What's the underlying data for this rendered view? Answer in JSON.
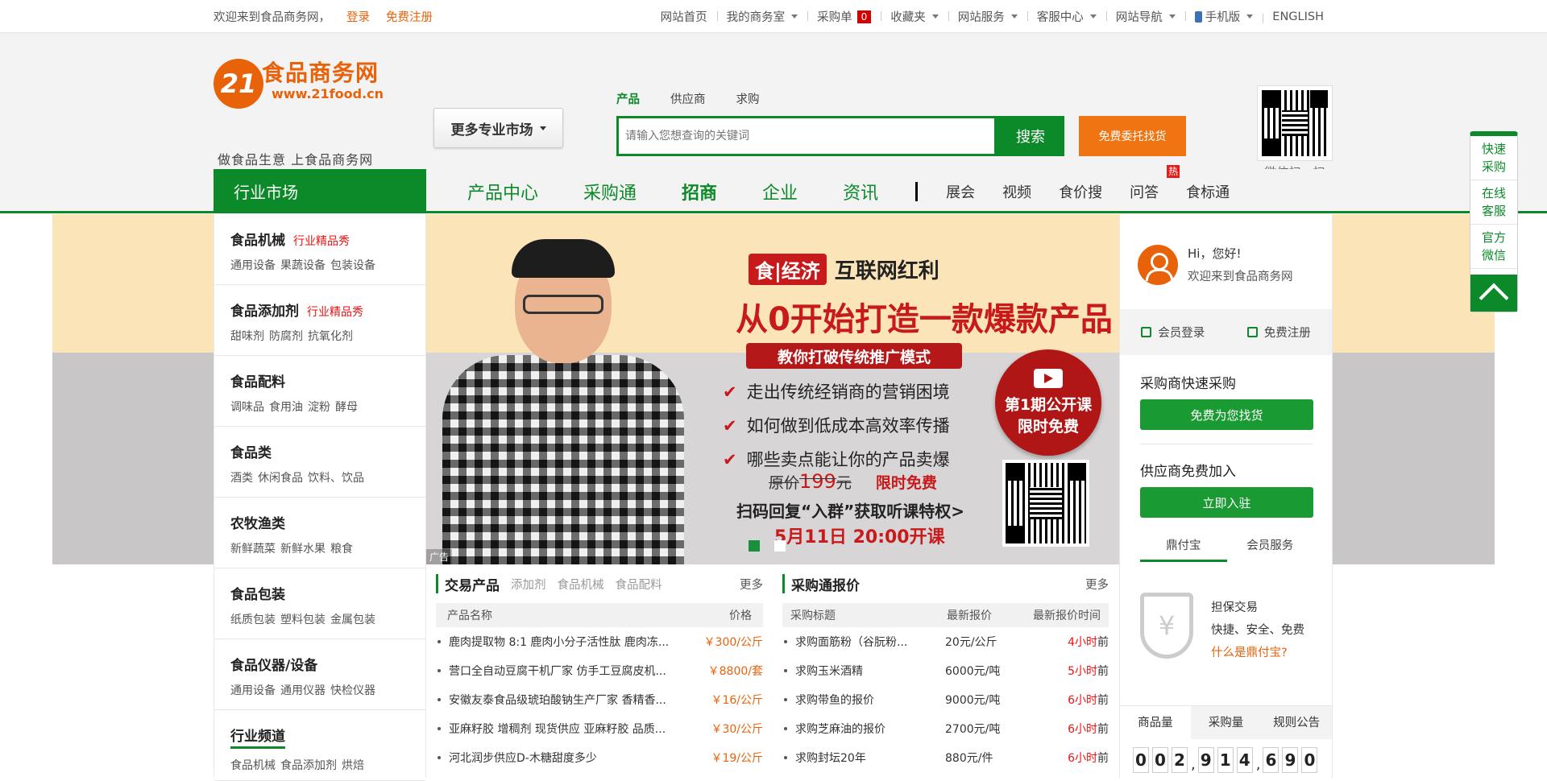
{
  "topbar": {
    "welcome": "欢迎来到食品商务网，",
    "login": "登录",
    "register": "免费注册",
    "links": [
      "网站首页",
      "我的商务室",
      "采购单",
      "收藏夹",
      "网站服务",
      "客服中心",
      "网站导航",
      "手机版",
      "ENGLISH"
    ],
    "cart_count": "0"
  },
  "header": {
    "logo_num": "21",
    "logo_cn": "食品商务网",
    "logo_url": "www.21food.cn",
    "slogan": "做食品生意 上食品商务网",
    "market_btn": "更多专业市场",
    "search_tabs": [
      "产品",
      "供应商",
      "求购"
    ],
    "search_placeholder": "请输入您想查询的关键词",
    "search_btn": "搜索",
    "entrust_btn": "免费委托找货",
    "qr_caption": "微信扫一扫"
  },
  "nav": {
    "category": "行业市场",
    "big_items": [
      "产品中心",
      "采购通",
      "招商",
      "企业",
      "资讯"
    ],
    "small_items": [
      "展会",
      "视频",
      "食价搜",
      "问答",
      "食标通"
    ],
    "hot_badge": "热"
  },
  "sidebar": {
    "groups": [
      {
        "title": "食品机械",
        "tag": "行业精品秀",
        "links": [
          "通用设备",
          "果蔬设备",
          "包装设备"
        ]
      },
      {
        "title": "食品添加剂",
        "tag": "行业精品秀",
        "links": [
          "甜味剂",
          "防腐剂",
          "抗氧化剂"
        ]
      },
      {
        "title": "食品配料",
        "tag": "",
        "links": [
          "调味品",
          "食用油",
          "淀粉",
          "酵母"
        ]
      },
      {
        "title": "食品类",
        "tag": "",
        "links": [
          "酒类",
          "休闲食品",
          "饮料、饮品"
        ]
      },
      {
        "title": "农牧渔类",
        "tag": "",
        "links": [
          "新鲜蔬菜",
          "新鲜水果",
          "粮食"
        ]
      },
      {
        "title": "食品包装",
        "tag": "",
        "links": [
          "纸质包装",
          "塑料包装",
          "金属包装"
        ]
      },
      {
        "title": "食品仪器/设备",
        "tag": "",
        "links": [
          "通用设备",
          "通用仪器",
          "快检仪器"
        ]
      },
      {
        "title": "行业频道",
        "tag": "",
        "links": [
          "食品机械",
          "食品添加剂",
          "烘焙"
        ]
      }
    ]
  },
  "banner": {
    "tag_red": "食|经济",
    "tag_text": "互联网红利",
    "title": "从0开始打造一款爆款产品",
    "subtitle": "教你打破传统推广模式",
    "points": [
      "走出传统经销商的营销困境",
      "如何做到低成本高效率传播",
      "哪些卖点能让你的产品卖爆"
    ],
    "old_price_label": "原价",
    "old_price": "199",
    "old_price_unit": "元",
    "free": "限时免费",
    "scan": "扫码回复“入群”获取听课特权>",
    "date": "5月11日 20:00开课",
    "circle_l1": "第1期公开课",
    "circle_l2": "限时免费",
    "ad": "广告"
  },
  "trade": {
    "title": "交易产品",
    "tags": [
      "添加剂",
      "食品机械",
      "食品配料"
    ],
    "more": "更多",
    "col_name": "产品名称",
    "col_price": "价格",
    "rows": [
      {
        "name": "鹿肉提取物 8:1 鹿肉小分子活性肽 鹿肉冻...",
        "price": "￥300/公斤"
      },
      {
        "name": "营口全自动豆腐干机厂家 仿手工豆腐皮机...",
        "price": "￥8800/套"
      },
      {
        "name": "安徽友泰食品级琥珀酸钠生产厂家 香精香...",
        "price": "￥16/公斤"
      },
      {
        "name": "亚麻籽胶 增稠剂 现货供应 亚麻籽胶 品质...",
        "price": "￥30/公斤"
      },
      {
        "name": "河北润步供应D-木糖甜度多少",
        "price": "￥19/公斤"
      }
    ]
  },
  "purchase": {
    "title": "采购通报价",
    "more": "更多",
    "cols": [
      "采购标题",
      "最新报价",
      "最新报价时间"
    ],
    "rows": [
      {
        "title": "求购面筋粉（谷朊粉...",
        "price": "20元/公斤",
        "num": "4",
        "unit": "小时",
        "suffix": "前"
      },
      {
        "title": "求购玉米酒精",
        "price": "6000元/吨",
        "num": "5",
        "unit": "小时",
        "suffix": "前"
      },
      {
        "title": "求购带鱼的报价",
        "price": "9000元/吨",
        "num": "6",
        "unit": "小时",
        "suffix": "前"
      },
      {
        "title": "求购芝麻油的报价",
        "price": "2700元/吨",
        "num": "6",
        "unit": "小时",
        "suffix": "前"
      },
      {
        "title": "求购封坛20年",
        "price": "880元/件",
        "num": "6",
        "unit": "小时",
        "suffix": "前"
      }
    ]
  },
  "right": {
    "hi": "Hi，您好!",
    "welcome": "欢迎来到食品商务网",
    "login": "会员登录",
    "register": "免费注册",
    "buyer_title": "采购商快速采购",
    "buyer_btn": "免费为您找货",
    "supplier_title": "供应商免费加入",
    "supplier_btn": "立即入驻",
    "tabs": [
      "鼎付宝",
      "会员服务"
    ],
    "guar_l1": "担保交易",
    "guar_l2": "快捷、安全、免费",
    "guar_l3": "什么是鼎付宝?",
    "stat_tabs": [
      "商品量",
      "采购量",
      "规则公告"
    ],
    "digits": [
      "0",
      "0",
      "2",
      "9",
      "1",
      "4",
      "6",
      "9",
      "0"
    ]
  },
  "float": {
    "items": [
      "快速采购",
      "在线客服",
      "官方微信"
    ]
  }
}
